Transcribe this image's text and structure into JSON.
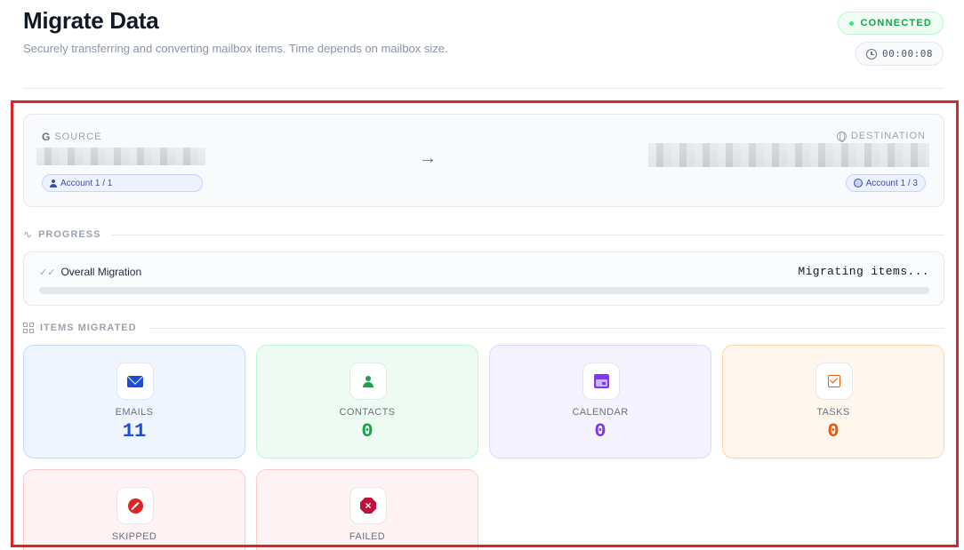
{
  "header": {
    "title": "Migrate Data",
    "subtitle": "Securely transferring and converting mailbox items. Time depends on mailbox size.",
    "status": "CONNECTED",
    "status_color": "#16a34a",
    "elapsed": "00:00:08"
  },
  "route": {
    "source_label": "SOURCE",
    "source_icon": "google-g-icon",
    "source_account": "Account  1 / 1",
    "destination_label": "DESTINATION",
    "destination_icon": "globe-icon",
    "destination_account": "Account  1 / 3",
    "arrow_glyph": "→"
  },
  "progress": {
    "section_label": "PROGRESS",
    "title": "Overall Migration",
    "status_text": "Migrating items...",
    "fraction": 0
  },
  "items": {
    "section_label": "ITEMS MIGRATED",
    "tiles": [
      {
        "label": "EMAILS",
        "value": "11",
        "icon": "mail-icon",
        "color": "#1d4ed8"
      },
      {
        "label": "CONTACTS",
        "value": "0",
        "icon": "person-icon",
        "color": "#16a34a"
      },
      {
        "label": "CALENDAR",
        "value": "0",
        "icon": "calendar-icon",
        "color": "#7c3aed"
      },
      {
        "label": "TASKS",
        "value": "0",
        "icon": "checkbox-icon",
        "color": "#ea580c"
      },
      {
        "label": "SKIPPED",
        "value": "",
        "icon": "prohibited-icon",
        "color": "#dc2626"
      },
      {
        "label": "FAILED",
        "value": "",
        "icon": "stop-x-icon",
        "color": "#be123c"
      }
    ]
  },
  "colors": {
    "accent": "#3b82f6",
    "highlight_frame": "#dc2626"
  }
}
